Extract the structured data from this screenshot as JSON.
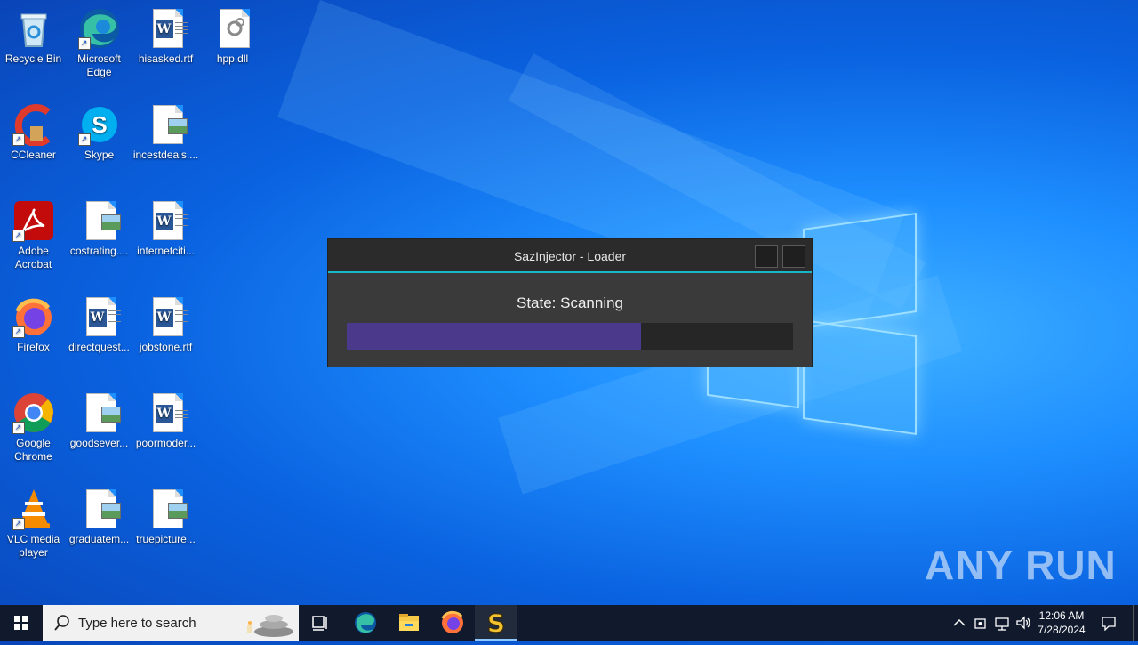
{
  "desktop": {
    "icons": [
      {
        "label": "Recycle Bin",
        "icon": "recycle-bin-icon"
      },
      {
        "label": "Microsoft Edge",
        "icon": "edge-icon"
      },
      {
        "label": "hisasked.rtf",
        "icon": "word-doc-icon"
      },
      {
        "label": "hpp.dll",
        "icon": "dll-file-icon"
      },
      {
        "label": "CCleaner",
        "icon": "ccleaner-icon"
      },
      {
        "label": "Skype",
        "icon": "skype-icon"
      },
      {
        "label": "incestdeals....",
        "icon": "image-file-icon"
      },
      {
        "label": "Adobe Acrobat",
        "icon": "acrobat-icon"
      },
      {
        "label": "costrating....",
        "icon": "image-file-icon"
      },
      {
        "label": "internetciti...",
        "icon": "word-doc-icon"
      },
      {
        "label": "Firefox",
        "icon": "firefox-icon"
      },
      {
        "label": "directquest...",
        "icon": "word-doc-icon"
      },
      {
        "label": "jobstone.rtf",
        "icon": "word-doc-icon"
      },
      {
        "label": "Google Chrome",
        "icon": "chrome-icon"
      },
      {
        "label": "goodsever...",
        "icon": "image-file-icon"
      },
      {
        "label": "poormoder...",
        "icon": "word-doc-icon"
      },
      {
        "label": "VLC media player",
        "icon": "vlc-icon"
      },
      {
        "label": "graduatem...",
        "icon": "image-file-icon"
      },
      {
        "label": "truepicture...",
        "icon": "image-file-icon"
      }
    ]
  },
  "loader": {
    "title": "SazInjector - Loader",
    "state": "State: Scanning",
    "progress_fraction": 0.66,
    "accent_color": "#19b6c8",
    "progress_color": "#4b3a8c"
  },
  "watermark": "ANY RUN",
  "taskbar": {
    "search_placeholder": "Type here to search",
    "time": "12:06 AM",
    "date": "7/28/2024",
    "pinned": [
      "task-view-icon",
      "edge-icon",
      "file-explorer-icon",
      "firefox-icon",
      "sazinjector-icon"
    ]
  }
}
